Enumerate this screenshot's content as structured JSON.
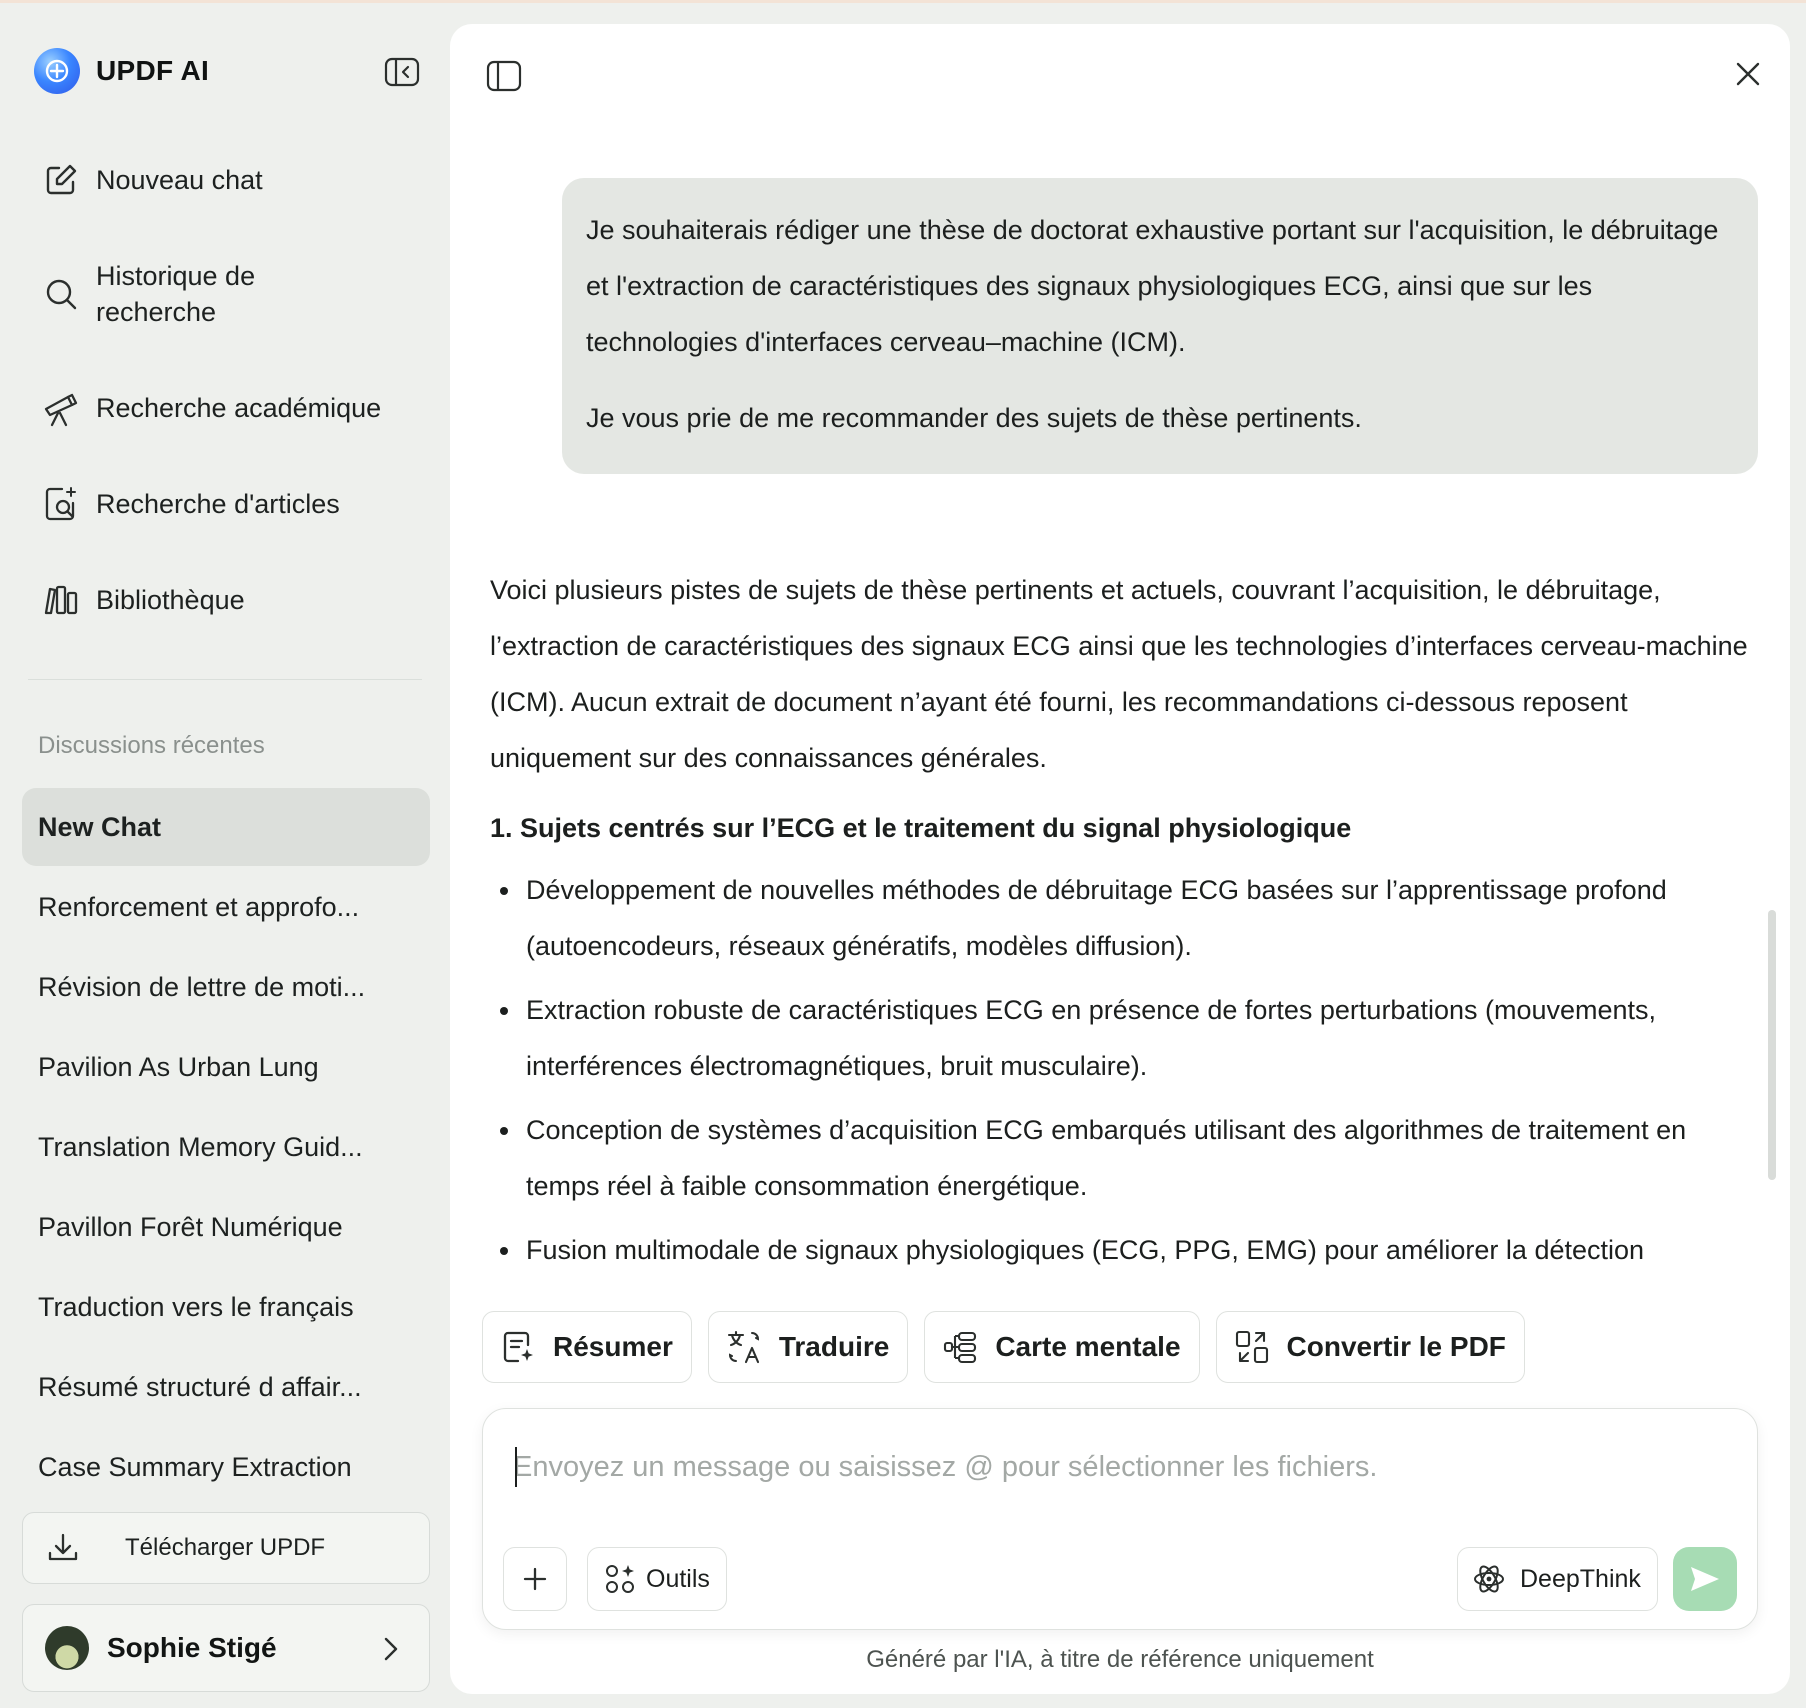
{
  "app": {
    "name": "UPDF AI"
  },
  "sidebar": {
    "nav": [
      {
        "label": "Nouveau chat",
        "icon": "new-chat-icon"
      },
      {
        "label": "Historique de recherche",
        "icon": "search-icon"
      },
      {
        "label": "Recherche académique",
        "icon": "telescope-icon"
      },
      {
        "label": "Recherche d'articles",
        "icon": "document-search-icon"
      },
      {
        "label": "Bibliothèque",
        "icon": "library-icon"
      }
    ],
    "history_line1": "Historique de",
    "history_line2": "recherche",
    "recent_title": "Discussions récentes",
    "recent": [
      "New Chat",
      "Renforcement et approfo...",
      "Révision de lettre de moti...",
      "Pavilion As Urban Lung",
      "Translation Memory Guid...",
      "Pavillon Forêt Numérique",
      "Traduction vers le français",
      "Résumé structuré d affair...",
      "Case Summary Extraction"
    ],
    "download_label": "Télécharger UPDF",
    "user_name": "Sophie Stigé"
  },
  "chat": {
    "user_message": [
      "Je souhaiterais rédiger une thèse de doctorat exhaustive portant sur l'acquisition, le débruitage et l'extraction de caractéristiques des signaux physiologiques ECG, ainsi que sur les technologies d'interfaces cerveau–machine (ICM).",
      "Je vous prie de me recommander des sujets de thèse pertinents."
    ],
    "answer_intro": "Voici plusieurs pistes de sujets de thèse pertinents et actuels, couvrant l’acquisition, le débruitage, l’extraction de caractéristiques des signaux ECG ainsi que les technologies d’interfaces cerveau-machine (ICM). Aucun extrait de document n’ayant été fourni, les recommandations ci-dessous reposent uniquement sur des connaissances générales.",
    "answer_heading": "1. Sujets centrés sur l’ECG et le traitement du signal physiologique",
    "answer_bullets": [
      "Développement de nouvelles méthodes de débruitage ECG basées sur l’apprentissage profond (autoencodeurs, réseaux génératifs, modèles diffusion).",
      "Extraction robuste de caractéristiques ECG en présence de fortes perturbations (mouvements, interférences électromagnétiques, bruit musculaire).",
      "Conception de systèmes d’acquisition ECG embarqués utilisant des algorithmes de traitement en temps réel à faible consommation énergétique.",
      "Fusion multimodale de signaux physiologiques (ECG, PPG, EMG) pour améliorer la détection"
    ]
  },
  "actions": [
    {
      "label": "Résumer",
      "icon": "summarize-icon"
    },
    {
      "label": "Traduire",
      "icon": "translate-icon"
    },
    {
      "label": "Carte mentale",
      "icon": "mindmap-icon"
    },
    {
      "label": "Convertir le PDF",
      "icon": "convert-icon"
    }
  ],
  "composer": {
    "placeholder": "Envoyez un message ou saisissez @ pour sélectionner les fichiers.",
    "tools_label": "Outils",
    "deepthink_label": "DeepThink"
  },
  "footer_note": "Généré par l'IA, à titre de référence uniquement",
  "colors": {
    "send_button": "#a7dcb4",
    "bubble": "#e4e7e3",
    "sidebar_bg": "#eef0ed",
    "active_item": "#dcdfdb"
  }
}
